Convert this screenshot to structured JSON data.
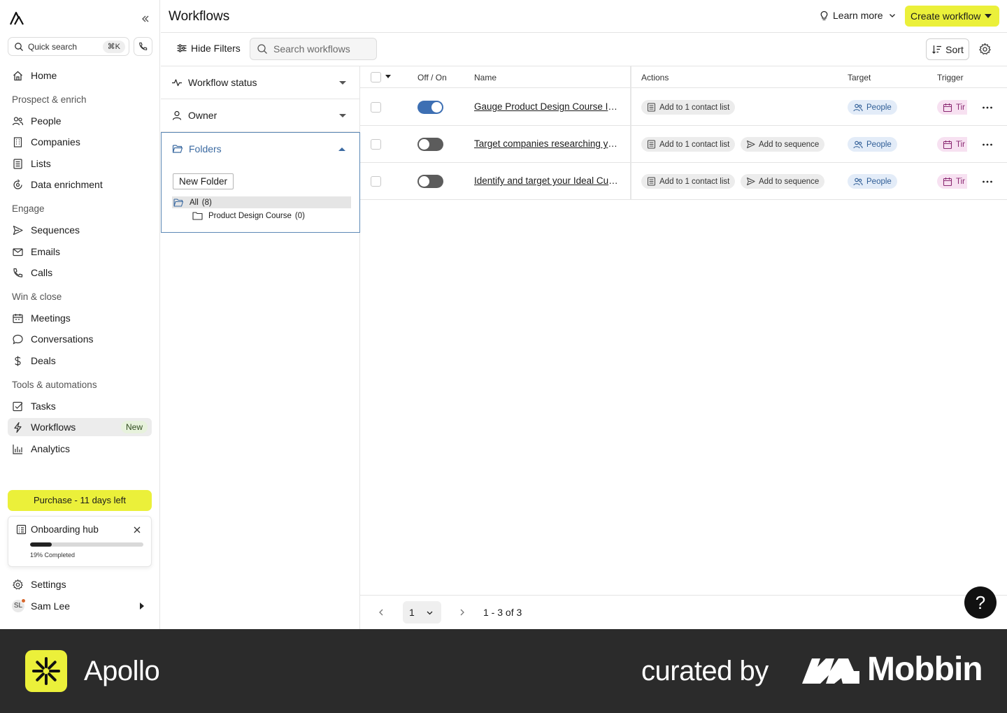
{
  "sidebar": {
    "quick_search": "Quick search",
    "quick_search_kbd": "⌘K",
    "home": "Home",
    "sections": {
      "prospect": "Prospect & enrich",
      "engage": "Engage",
      "win": "Win & close",
      "tools": "Tools & automations"
    },
    "items": {
      "people": "People",
      "companies": "Companies",
      "lists": "Lists",
      "data_enrichment": "Data enrichment",
      "sequences": "Sequences",
      "emails": "Emails",
      "calls": "Calls",
      "meetings": "Meetings",
      "conversations": "Conversations",
      "deals": "Deals",
      "tasks": "Tasks",
      "workflows": "Workflows",
      "workflows_badge": "New",
      "analytics": "Analytics"
    },
    "purchase": "Purchase - 11 days left",
    "onboarding": {
      "title": "Onboarding hub",
      "progress": 0.19,
      "progress_label": "19% Completed"
    },
    "settings": "Settings",
    "user": {
      "initials": "SL",
      "name": "Sam Lee"
    }
  },
  "header": {
    "title": "Workflows",
    "learn_more": "Learn more",
    "create": "Create workflow"
  },
  "toolbar": {
    "hide_filters": "Hide Filters",
    "search_placeholder": "Search workflows",
    "sort": "Sort"
  },
  "filters": {
    "workflow_status": "Workflow status",
    "owner": "Owner",
    "folders": "Folders",
    "new_folder": "New Folder",
    "all_label": "All",
    "all_count": "(8)",
    "sub_label": "Product Design Course",
    "sub_count": "(0)"
  },
  "table": {
    "columns": {
      "toggle": "Off / On",
      "name": "Name",
      "actions": "Actions",
      "target": "Target",
      "trigger": "Trigger"
    },
    "rows": [
      {
        "on": true,
        "name": "Gauge Product Design Course Int...",
        "action1": "Add to 1 contact list",
        "action2": "",
        "target": "People",
        "trigger": "Tir"
      },
      {
        "on": false,
        "name": "Target companies researching yo...",
        "action1": "Add to 1 contact list",
        "action2": "Add to sequence",
        "target": "People",
        "trigger": "Tir"
      },
      {
        "on": false,
        "name": "Identify and target your Ideal Cust...",
        "action1": "Add to 1 contact list",
        "action2": "Add to sequence",
        "target": "People",
        "trigger": "Tir"
      }
    ]
  },
  "pagination": {
    "page": "1",
    "range": "1 - 3 of 3"
  },
  "help": "?",
  "footer": {
    "app": "Apollo",
    "curated": "curated by",
    "brand": "Mobbin"
  },
  "colors": {
    "accent_yellow": "#ebf03a",
    "toggle_on": "#3d6fb3",
    "folder_blue": "#3b6aa1",
    "footer_bg": "#2b2b2b"
  }
}
